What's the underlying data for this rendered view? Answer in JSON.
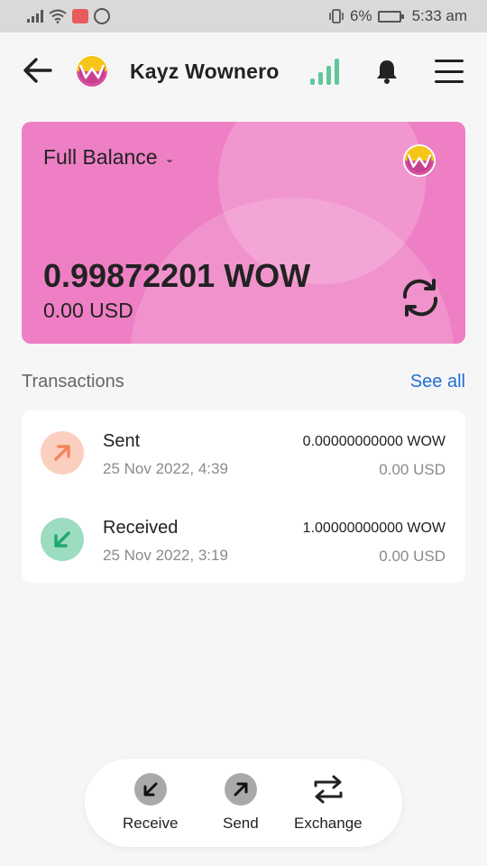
{
  "status_bar": {
    "battery_text": "6%",
    "time": "5:33 am"
  },
  "header": {
    "wallet_name": "Kayz Wownero",
    "sync_color": "#5fc79a"
  },
  "balance_card": {
    "selector_label": "Full Balance",
    "crypto_balance": "0.99872201 WOW",
    "fiat_balance": "0.00 USD",
    "card_color": "#ee7fc4"
  },
  "transactions": {
    "title": "Transactions",
    "see_all_label": "See all",
    "items": [
      {
        "type": "Sent",
        "date": "25 Nov 2022, 4:39",
        "amount": "0.00000000000 WOW",
        "fiat": "0.00 USD",
        "icon": "arrow-up-right-icon",
        "icon_bg": "#fbcfbf",
        "icon_color": "#f5855d"
      },
      {
        "type": "Received",
        "date": "25 Nov 2022, 3:19",
        "amount": "1.00000000000 WOW",
        "fiat": "0.00 USD",
        "icon": "arrow-down-left-icon",
        "icon_bg": "#9cdcc0",
        "icon_color": "#1fa86d"
      }
    ]
  },
  "bottom_nav": {
    "receive_label": "Receive",
    "send_label": "Send",
    "exchange_label": "Exchange"
  }
}
